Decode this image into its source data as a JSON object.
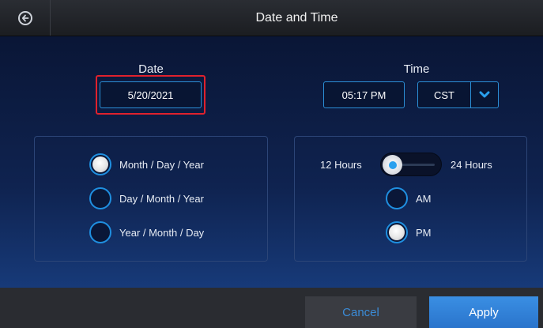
{
  "header": {
    "title": "Date and Time",
    "back_icon": "back-arrow-icon"
  },
  "date_section": {
    "label": "Date",
    "value": "5/20/2021"
  },
  "time_section": {
    "label": "Time",
    "time_value": "05:17 PM",
    "timezone_value": "CST",
    "dropdown_icon": "chevron-down-icon"
  },
  "date_format": {
    "options": [
      {
        "label": "Month / Day / Year",
        "selected": true
      },
      {
        "label": "Day / Month / Year",
        "selected": false
      },
      {
        "label": "Year / Month / Day",
        "selected": false
      }
    ]
  },
  "time_format": {
    "left_label": "12 Hours",
    "right_label": "24 Hours",
    "toggle_state": "12 Hours",
    "am_label": "AM",
    "pm_label": "PM",
    "selected_period": "PM"
  },
  "footer": {
    "cancel_label": "Cancel",
    "apply_label": "Apply"
  },
  "colors": {
    "accent": "#2b8fd6",
    "highlight": "#e0212d",
    "apply": "#2f7fd8"
  }
}
